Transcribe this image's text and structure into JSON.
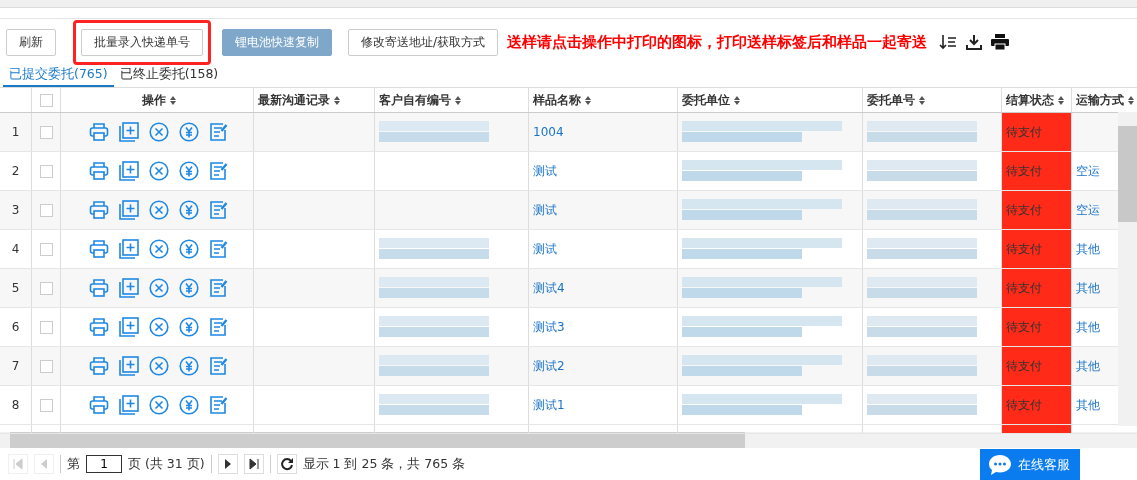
{
  "toolbar": {
    "buttons": [
      {
        "label": "刷新",
        "kind": "plain",
        "highlighted": false
      },
      {
        "label": "批量录入快递单号",
        "kind": "plain",
        "highlighted": true
      },
      {
        "label": "锂电池快速复制",
        "kind": "primary",
        "highlighted": false
      },
      {
        "label": "修改寄送地址/获取方式",
        "kind": "plain",
        "highlighted": false
      }
    ],
    "notice": "送样请点击操作中打印的图标，打印送样标签后和样品一起寄送"
  },
  "tabs": [
    {
      "label": "已提交委托(765)",
      "selected": true
    },
    {
      "label": "已终止委托(158)",
      "selected": false
    }
  ],
  "table": {
    "all_checked": false,
    "columns": [
      "操作",
      "最新沟通记录",
      "客户自有编号",
      "样品名称",
      "委托单位",
      "委托单号",
      "结算状态",
      "运输方式"
    ],
    "rows": [
      {
        "index": "1",
        "checked": false,
        "client_no_blurred": true,
        "sample_name": "1004",
        "settlement": "待支付"
      },
      {
        "index": "2",
        "checked": false,
        "client_no_blurred": false,
        "sample_name": "测试",
        "settlement": "待支付",
        "transport": "空运"
      },
      {
        "index": "3",
        "checked": false,
        "client_no_blurred": false,
        "sample_name": "测试",
        "settlement": "待支付",
        "transport": "空运"
      },
      {
        "index": "4",
        "checked": false,
        "client_no_blurred": true,
        "sample_name": "测试",
        "settlement": "待支付",
        "transport": "其他"
      },
      {
        "index": "5",
        "checked": false,
        "client_no_blurred": true,
        "sample_name": "测试4",
        "settlement": "待支付",
        "transport": "其他"
      },
      {
        "index": "6",
        "checked": false,
        "client_no_blurred": true,
        "sample_name": "测试3",
        "settlement": "待支付",
        "transport": "其他"
      },
      {
        "index": "7",
        "checked": false,
        "client_no_blurred": true,
        "sample_name": "测试2",
        "settlement": "待支付",
        "transport": "其他"
      },
      {
        "index": "8",
        "checked": false,
        "client_no_blurred": true,
        "sample_name": "测试1",
        "settlement": "待支付",
        "transport": "其他"
      }
    ]
  },
  "pager": {
    "first_disabled": true,
    "prev_disabled": true,
    "page_prefix": "第",
    "page": "1",
    "page_suffix": "页 (共 31 页)",
    "summary": "显示 1 到 25 条，共 765 条"
  },
  "chat_button": {
    "label": "在线客服"
  }
}
